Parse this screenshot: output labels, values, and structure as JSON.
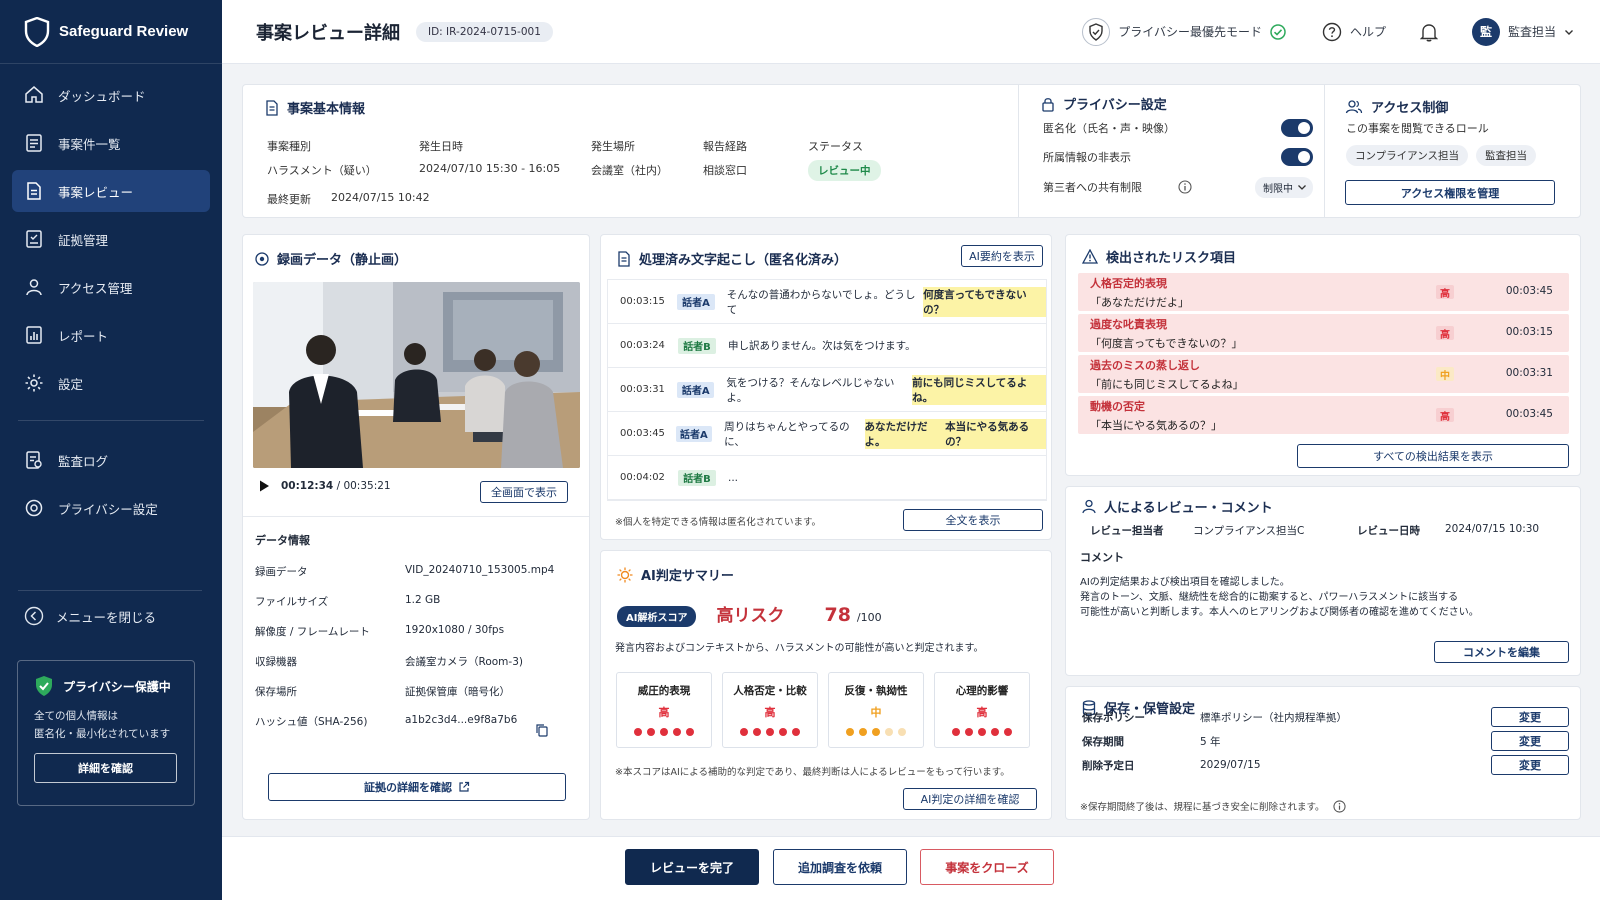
{
  "app": {
    "name": "Safeguard Review"
  },
  "nav": {
    "items": [
      {
        "label": "ダッシュボード",
        "icon": "home-icon"
      },
      {
        "label": "事案件一覧",
        "icon": "list-icon"
      },
      {
        "label": "事案レビュー",
        "icon": "document-icon",
        "active": true
      },
      {
        "label": "証拠管理",
        "icon": "evidence-icon"
      },
      {
        "label": "アクセス管理",
        "icon": "user-icon"
      },
      {
        "label": "レポート",
        "icon": "report-icon"
      },
      {
        "label": "設定",
        "icon": "gear-icon"
      }
    ],
    "items2": [
      {
        "label": "監査ログ",
        "icon": "audit-log-icon"
      },
      {
        "label": "プライバシー設定",
        "icon": "privacy-gear-icon"
      }
    ],
    "collapse_label": "メニューを閉じる"
  },
  "privacy_box": {
    "title": "プライバシー保護中",
    "desc_line1": "全ての個人情報は",
    "desc_line2": "匿名化・最小化されています",
    "button": "詳細を確認"
  },
  "header": {
    "title": "事案レビュー詳細",
    "case_id": "ID: IR-2024-0715-001",
    "privacy_mode": "プライバシー最優先モード",
    "help": "ヘルプ",
    "user_initial": "監",
    "user_name": "監査担当"
  },
  "basic": {
    "title": "事案基本情報",
    "fields": [
      {
        "label": "事案種別",
        "value": "ハラスメント（疑い）"
      },
      {
        "label": "発生日時",
        "value": "2024/07/10 15:30 - 16:05"
      },
      {
        "label": "発生場所",
        "value": "会議室（社内）"
      },
      {
        "label": "報告経路",
        "value": "相談窓口"
      }
    ],
    "status_label": "ステータス",
    "status_value": "レビュー中",
    "updated_label": "最終更新",
    "updated_value": "2024/07/15 10:42"
  },
  "privacy": {
    "title": "プライバシー設定",
    "anonymize": "匿名化（氏名・声・映像）",
    "hide_affiliation": "所属情報の非表示",
    "third_party": "第三者への共有制限",
    "third_party_value": "制限中"
  },
  "access": {
    "title": "アクセス制御",
    "desc": "この事案を閲覧できるロール",
    "roles": [
      "コンプライアンス担当",
      "監査担当"
    ],
    "button": "アクセス権限を管理"
  },
  "video": {
    "title": "録画データ（静止画）",
    "time_current": "00:12:34",
    "time_total": " / 00:35:21",
    "fullscreen": "全画面で表示",
    "info_title": "データ情報",
    "info": [
      {
        "label": "録画データ",
        "value": "VID_20240710_153005.mp4"
      },
      {
        "label": "ファイルサイズ",
        "value": "1.2 GB"
      },
      {
        "label": "解像度 / フレームレート",
        "value": "1920x1080 / 30fps"
      },
      {
        "label": "収録機器",
        "value": "会議室カメラ（Room-3)"
      },
      {
        "label": "保存場所",
        "value": "証拠保管庫（暗号化）"
      },
      {
        "label": "ハッシュ値（SHA-256)",
        "value": "a1b2c3d4...e9f8a7b6"
      }
    ],
    "evidence_button": "証拠の詳細を確認"
  },
  "transcript": {
    "title": "処理済み文字起こし（匿名化済み）",
    "ai_summary_button": "AI要約を表示",
    "rows": [
      {
        "time": "00:03:15",
        "speaker": "話者A",
        "text": "そんなの普通わからないでしょ。どうして",
        "highlight": "何度言ってもできないの？",
        "text2": ""
      },
      {
        "time": "00:03:24",
        "speaker": "話者B",
        "text": "申し訳ありません。次は気をつけます。",
        "highlight": "",
        "text2": ""
      },
      {
        "time": "00:03:31",
        "speaker": "話者A",
        "text": "気をつける？そんなレベルじゃないよ。",
        "highlight": "前にも同じミスしてるよね。",
        "text2": ""
      },
      {
        "time": "00:03:45",
        "speaker": "話者A",
        "text": "周りはちゃんとやってるのに、",
        "highlight": "あなただけだよ。",
        "text2": "本当にやる気あるの？"
      },
      {
        "time": "00:04:02",
        "speaker": "話者B",
        "text": "...",
        "highlight": "",
        "text2": ""
      }
    ],
    "note": "※個人を特定できる情報は匿名化されています。",
    "full_button": "全文を表示"
  },
  "ai_summary": {
    "title": "AI判定サマリー",
    "score_label": "AI解析スコア",
    "risk": "高リスク",
    "score": "78",
    "score_max": "/100",
    "desc": "発言内容およびコンテキストから、ハラスメントの可能性が高いと判定されます。",
    "metrics": [
      {
        "label": "威圧的表現",
        "level": "高",
        "score": 5
      },
      {
        "label": "人格否定・比較",
        "level": "高",
        "score": 5
      },
      {
        "label": "反復・執拗性",
        "level": "中",
        "score": 3
      },
      {
        "label": "心理的影響",
        "level": "高",
        "score": 5
      }
    ],
    "note": "※本スコアはAIによる補助的な判定であり、最終判断は人によるレビューをもって行います。",
    "detail_button": "AI判定の詳細を確認"
  },
  "risks": {
    "title": "検出されたリスク項目",
    "items": [
      {
        "name": "人格否定的表現",
        "quote": "「あなただけだよ」",
        "level": "高",
        "time": "00:03:45"
      },
      {
        "name": "過度な叱責表現",
        "quote": "「何度言ってもできないの？」",
        "level": "高",
        "time": "00:03:15"
      },
      {
        "name": "過去のミスの蒸し返し",
        "quote": "「前にも同じミスしてるよね」",
        "level": "中",
        "time": "00:03:31"
      },
      {
        "name": "動機の否定",
        "quote": "「本当にやる気あるの？」",
        "level": "高",
        "time": "00:03:45"
      }
    ],
    "all_button": "すべての検出結果を表示"
  },
  "review": {
    "title": "人によるレビュー・コメント",
    "reviewer_label": "レビュー担当者",
    "reviewer": "コンプライアンス担当C",
    "date_label": "レビュー日時",
    "date": "2024/07/15 10:30",
    "comment_label": "コメント",
    "comment_l1": "AIの判定結果および検出項目を確認しました。",
    "comment_l2": "発言のトーン、文脈、継続性を総合的に勘案すると、パワーハラスメントに該当する",
    "comment_l3": "可能性が高いと判断します。本人へのヒアリングおよび関係者の確認を進めてください。",
    "edit_button": "コメントを編集"
  },
  "retention": {
    "title": "保存・保管設定",
    "rows": [
      {
        "label": "保存ポリシー",
        "value": "標準ポリシー（社内規程準拠）",
        "button": "変更"
      },
      {
        "label": "保存期間",
        "value": "5 年",
        "button": "変更"
      },
      {
        "label": "削除予定日",
        "value": "2029/07/15",
        "button": "変更"
      }
    ],
    "note": "※保存期間終了後は、規程に基づき安全に削除されます。"
  },
  "footer": {
    "complete": "レビューを完了",
    "investigate": "追加調査を依頼",
    "close": "事案をクローズ"
  },
  "colors": {
    "navy": "#10294f",
    "primary": "#1b3a6b",
    "danger": "#c4323b",
    "high": "#e0303c",
    "medium": "#f0a020",
    "ok": "#1f8a4a"
  }
}
